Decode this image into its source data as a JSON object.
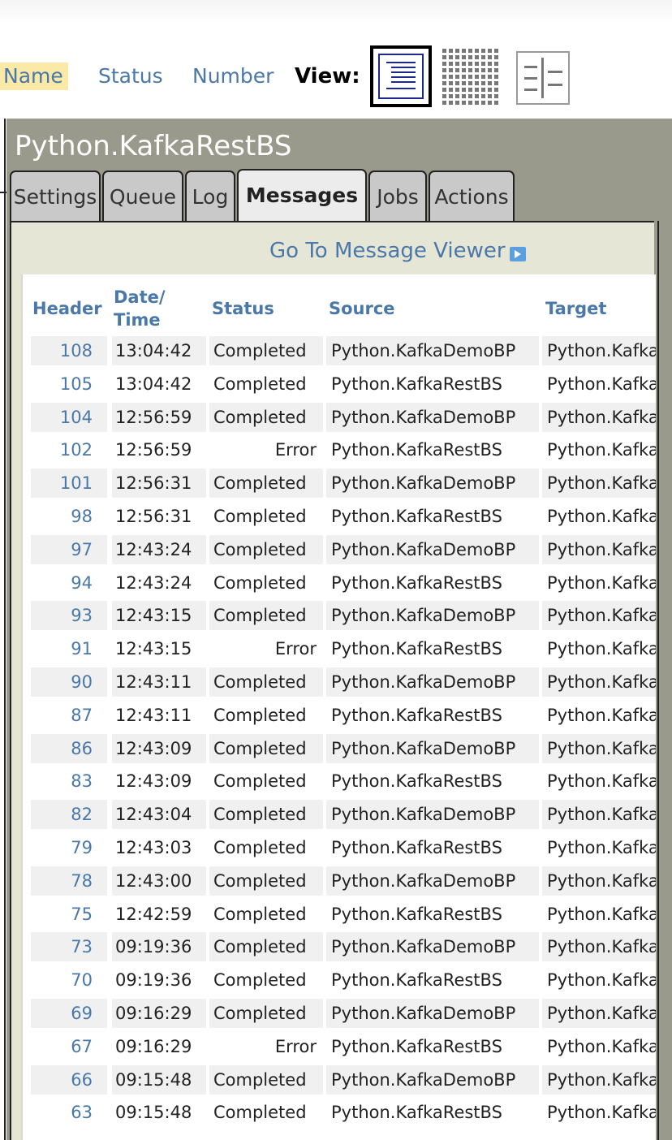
{
  "sort": {
    "name": "Name",
    "status": "Status",
    "number": "Number"
  },
  "view": {
    "label": "View:",
    "options": [
      "list-view-icon",
      "grid-view-icon",
      "split-view-icon"
    ],
    "selected": "list-view-icon"
  },
  "panel": {
    "title": "Python.KafkaRestBS",
    "tabs": [
      "Settings",
      "Queue",
      "Log",
      "Messages",
      "Jobs",
      "Actions"
    ],
    "active_tab": "Messages"
  },
  "goto_link": "Go To Message Viewer",
  "table": {
    "columns": {
      "header": "Header",
      "datetime_line1": "Date/",
      "datetime_line2": "Time",
      "status": "Status",
      "source": "Source",
      "target": "Target"
    },
    "rows": [
      {
        "header": "108",
        "time": "13:04:42",
        "status": "Completed",
        "source": "Python.KafkaDemoBP",
        "target": "Python.KafkaRestBS"
      },
      {
        "header": "105",
        "time": "13:04:42",
        "status": "Completed",
        "source": "Python.KafkaRestBS",
        "target": "Python.KafkaDemoBP"
      },
      {
        "header": "104",
        "time": "12:56:59",
        "status": "Completed",
        "source": "Python.KafkaDemoBP",
        "target": "Python.KafkaRestBS"
      },
      {
        "header": "102",
        "time": "12:56:59",
        "status": "Error",
        "source": "Python.KafkaRestBS",
        "target": "Python.KafkaDemoBP"
      },
      {
        "header": "101",
        "time": "12:56:31",
        "status": "Completed",
        "source": "Python.KafkaDemoBP",
        "target": "Python.KafkaRestBS"
      },
      {
        "header": "98",
        "time": "12:56:31",
        "status": "Completed",
        "source": "Python.KafkaRestBS",
        "target": "Python.KafkaDemoBP"
      },
      {
        "header": "97",
        "time": "12:43:24",
        "status": "Completed",
        "source": "Python.KafkaDemoBP",
        "target": "Python.KafkaRestBS"
      },
      {
        "header": "94",
        "time": "12:43:24",
        "status": "Completed",
        "source": "Python.KafkaRestBS",
        "target": "Python.KafkaDemoBP"
      },
      {
        "header": "93",
        "time": "12:43:15",
        "status": "Completed",
        "source": "Python.KafkaDemoBP",
        "target": "Python.KafkaRestBS"
      },
      {
        "header": "91",
        "time": "12:43:15",
        "status": "Error",
        "source": "Python.KafkaRestBS",
        "target": "Python.KafkaDemoBP"
      },
      {
        "header": "90",
        "time": "12:43:11",
        "status": "Completed",
        "source": "Python.KafkaDemoBP",
        "target": "Python.KafkaRestBS"
      },
      {
        "header": "87",
        "time": "12:43:11",
        "status": "Completed",
        "source": "Python.KafkaRestBS",
        "target": "Python.KafkaDemoBP"
      },
      {
        "header": "86",
        "time": "12:43:09",
        "status": "Completed",
        "source": "Python.KafkaDemoBP",
        "target": "Python.KafkaRestBS"
      },
      {
        "header": "83",
        "time": "12:43:09",
        "status": "Completed",
        "source": "Python.KafkaRestBS",
        "target": "Python.KafkaDemoBP"
      },
      {
        "header": "82",
        "time": "12:43:04",
        "status": "Completed",
        "source": "Python.KafkaDemoBP",
        "target": "Python.KafkaRestBS"
      },
      {
        "header": "79",
        "time": "12:43:03",
        "status": "Completed",
        "source": "Python.KafkaRestBS",
        "target": "Python.KafkaDemoBP"
      },
      {
        "header": "78",
        "time": "12:43:00",
        "status": "Completed",
        "source": "Python.KafkaDemoBP",
        "target": "Python.KafkaRestBS"
      },
      {
        "header": "75",
        "time": "12:42:59",
        "status": "Completed",
        "source": "Python.KafkaRestBS",
        "target": "Python.KafkaDemoBP"
      },
      {
        "header": "73",
        "time": "09:19:36",
        "status": "Completed",
        "source": "Python.KafkaDemoBP",
        "target": "Python.KafkaRestBS"
      },
      {
        "header": "70",
        "time": "09:19:36",
        "status": "Completed",
        "source": "Python.KafkaRestBS",
        "target": "Python.KafkaDemoBP"
      },
      {
        "header": "69",
        "time": "09:16:29",
        "status": "Completed",
        "source": "Python.KafkaDemoBP",
        "target": "Python.KafkaRestBS"
      },
      {
        "header": "67",
        "time": "09:16:29",
        "status": "Error",
        "source": "Python.KafkaRestBS",
        "target": "Python.KafkaDemoBP"
      },
      {
        "header": "66",
        "time": "09:15:48",
        "status": "Completed",
        "source": "Python.KafkaDemoBP",
        "target": "Python.KafkaRestBS"
      },
      {
        "header": "63",
        "time": "09:15:48",
        "status": "Completed",
        "source": "Python.KafkaRestBS",
        "target": "Python.KafkaDemoBP"
      }
    ]
  },
  "colors": {
    "link": "#4a78a8",
    "panel_bg": "#9a9a8c",
    "content_bg": "#e6e6d7",
    "sort_highlight": "#fbe9a8",
    "row_stripe": "#f0f0f0"
  }
}
